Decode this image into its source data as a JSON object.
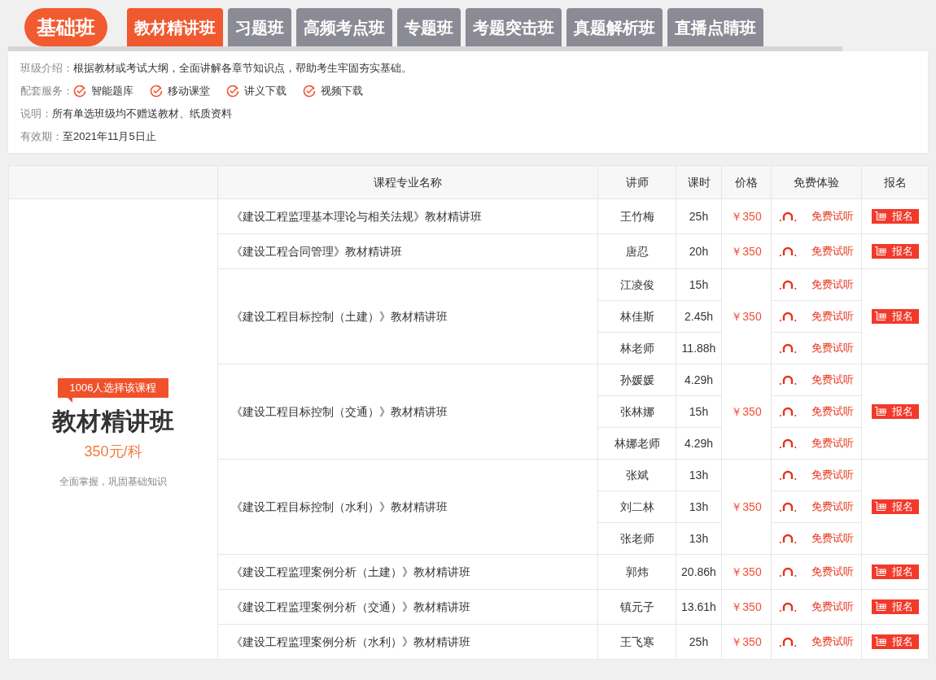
{
  "level_badge": "基础班",
  "tabs": [
    {
      "label": "教材精讲班",
      "selected": true
    },
    {
      "label": "习题班",
      "selected": false
    },
    {
      "label": "高频考点班",
      "selected": false
    },
    {
      "label": "专题班",
      "selected": false
    },
    {
      "label": "考题突击班",
      "selected": false
    },
    {
      "label": "真题解析班",
      "selected": false
    },
    {
      "label": "直播点睛班",
      "selected": false
    }
  ],
  "info": {
    "intro_label": "班级介绍：",
    "intro": "根据教材或考试大纲，全面讲解各章节知识点，帮助考生牢固夯实基础。",
    "services_label": "配套服务：",
    "services": [
      "智能题库",
      "移动课堂",
      "讲义下载",
      "视频下载"
    ],
    "note_label": "说明：",
    "note": "所有单选班级均不赠送教材、纸质资料",
    "validity_label": "有效期：",
    "validity": "至2021年11月5日止"
  },
  "table": {
    "columns": [
      "课程专业名称",
      "讲师",
      "课时",
      "价格",
      "免费体验",
      "报名"
    ],
    "summary": {
      "tag": "1006人选择该课程",
      "title": "教材精讲班",
      "price": "350元/科",
      "slogan": "全面掌握，巩固基础知识"
    },
    "rows": [
      {
        "name": "《建设工程监理基本理论与相关法规》教材精讲班",
        "price": "￥350",
        "signup": "报名",
        "teachers": [
          {
            "name": "王竹梅",
            "hours": "25h",
            "trial": "免费试听"
          }
        ]
      },
      {
        "name": "《建设工程合同管理》教材精讲班",
        "price": "￥350",
        "signup": "报名",
        "teachers": [
          {
            "name": "唐忍",
            "hours": "20h",
            "trial": "免费试听"
          }
        ]
      },
      {
        "name": "《建设工程目标控制（土建）》教材精讲班",
        "price": "￥350",
        "signup": "报名",
        "teachers": [
          {
            "name": "江凌俊",
            "hours": "15h",
            "trial": "免费试听"
          },
          {
            "name": "林佳斯",
            "hours": "2.45h",
            "trial": "免费试听"
          },
          {
            "name": "林老师",
            "hours": "11.88h",
            "trial": "免费试听"
          }
        ]
      },
      {
        "name": "《建设工程目标控制（交通）》教材精讲班",
        "price": "￥350",
        "signup": "报名",
        "teachers": [
          {
            "name": "孙媛媛",
            "hours": "4.29h",
            "trial": "免费试听"
          },
          {
            "name": "张林娜",
            "hours": "15h",
            "trial": "免费试听"
          },
          {
            "name": "林娜老师",
            "hours": "4.29h",
            "trial": "免费试听"
          }
        ]
      },
      {
        "name": "《建设工程目标控制（水利）》教材精讲班",
        "price": "￥350",
        "signup": "报名",
        "teachers": [
          {
            "name": "张斌",
            "hours": "13h",
            "trial": "免费试听"
          },
          {
            "name": "刘二林",
            "hours": "13h",
            "trial": "免费试听"
          },
          {
            "name": "张老师",
            "hours": "13h",
            "trial": "免费试听"
          }
        ]
      },
      {
        "name": "《建设工程监理案例分析（土建）》教材精讲班",
        "price": "￥350",
        "signup": "报名",
        "teachers": [
          {
            "name": "郭炜",
            "hours": "20.86h",
            "trial": "免费试听"
          }
        ]
      },
      {
        "name": "《建设工程监理案例分析（交通）》教材精讲班",
        "price": "￥350",
        "signup": "报名",
        "teachers": [
          {
            "name": "镇元子",
            "hours": "13.61h",
            "trial": "免费试听"
          }
        ]
      },
      {
        "name": "《建设工程监理案例分析（水利）》教材精讲班",
        "price": "￥350",
        "signup": "报名",
        "teachers": [
          {
            "name": "王飞寒",
            "hours": "25h",
            "trial": "免费试听"
          }
        ]
      }
    ]
  }
}
